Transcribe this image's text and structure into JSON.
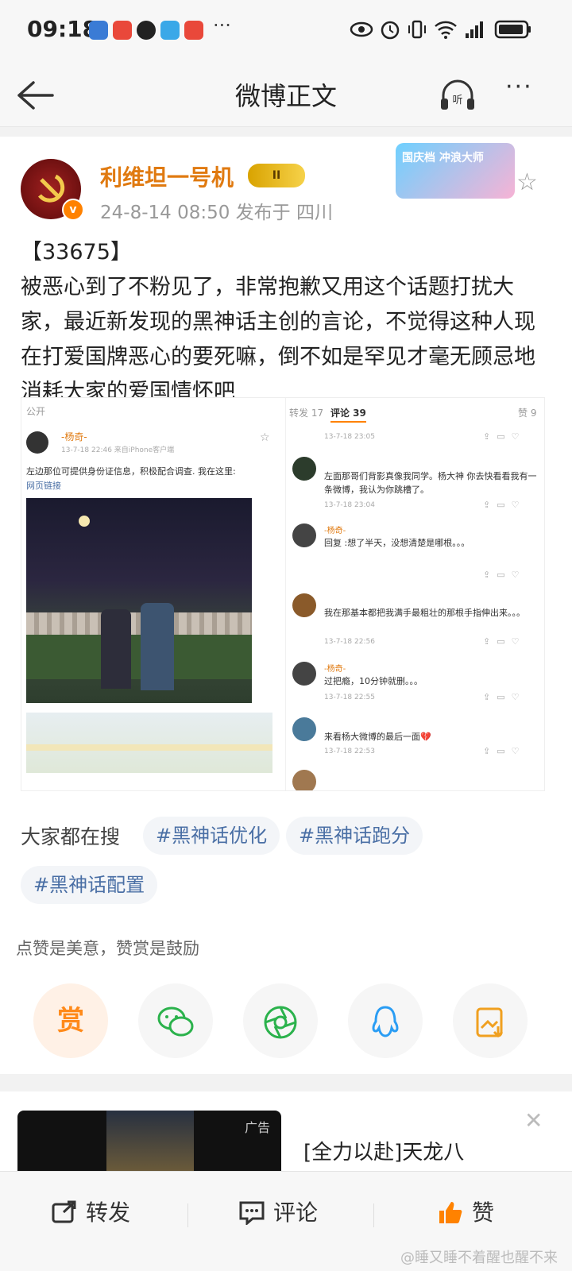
{
  "status_bar": {
    "time": "09:18",
    "more": "···"
  },
  "nav": {
    "title": "微博正文",
    "listen_label": "听",
    "more": "···"
  },
  "post": {
    "username": "利维坦一号机",
    "level_badge": "II",
    "verified_badge": "v",
    "meta": "24-8-14 08:50  发布于 四川",
    "festival_badge": "国庆档 冲浪大师",
    "text_number": "【33675】",
    "text_body": "被恶心到了不粉见了，非常抱歉又用这个话题打扰大家，最近新发现的黑神话主创的言论，不觉得这种人现在打爱国牌恶心的要死嘛，倒不如是罕见才毫无顾忌地消耗大家的爱国情怀吧"
  },
  "embedded": {
    "left": {
      "public": "公开",
      "user": "-杨奇-",
      "date": "13-7-18 22:46 来自iPhone客户端",
      "text": "左边那位可提供身份证信息，积极配合调查. 我在这里:",
      "link": "网页链接"
    },
    "right": {
      "tab_repost": "转发 17",
      "tab_comment": "评论 39",
      "tab_like": "赞 9",
      "comments": [
        {
          "name": "",
          "text": "",
          "date": "13-7-18 23:05"
        },
        {
          "name": "",
          "text": "左面那哥们背影真像我同学。杨大神 你去快看看我有一条微博，我认为你跳槽了。",
          "date": "13-7-18 23:04"
        },
        {
          "name": "-杨奇-",
          "text": "回复 :想了半天，没想清楚是哪根。。。",
          "date": ""
        },
        {
          "name": "",
          "text": "我在那基本都把我满手最粗壮的那根手指伸出来。。。",
          "date": "13-7-18 22:56"
        },
        {
          "name": "-杨奇-",
          "text": "过把瘾，10分钟就删。。。",
          "date": "13-7-18 22:55"
        },
        {
          "name": "",
          "text": "来看杨大微博的最后一面💔",
          "date": "13-7-18 22:53"
        }
      ]
    }
  },
  "hot_search": {
    "label": "大家都在搜",
    "tags": [
      "#黑神话优化",
      "#黑神话跑分",
      "#黑神话配置"
    ]
  },
  "reward": {
    "note": "点赞是美意，赞赏是鼓励",
    "reward_label": "赏"
  },
  "ad": {
    "tag": "广告",
    "title": "[全力以赴]天龙八"
  },
  "bottom_bar": {
    "repost": "转发",
    "comment": "评论",
    "like": "赞",
    "watermark": "@睡又睡不着醒也醒不来"
  },
  "colors": {
    "accent_orange": "#ff8200",
    "username": "#e07a10",
    "link_blue": "#4a6fa5"
  }
}
